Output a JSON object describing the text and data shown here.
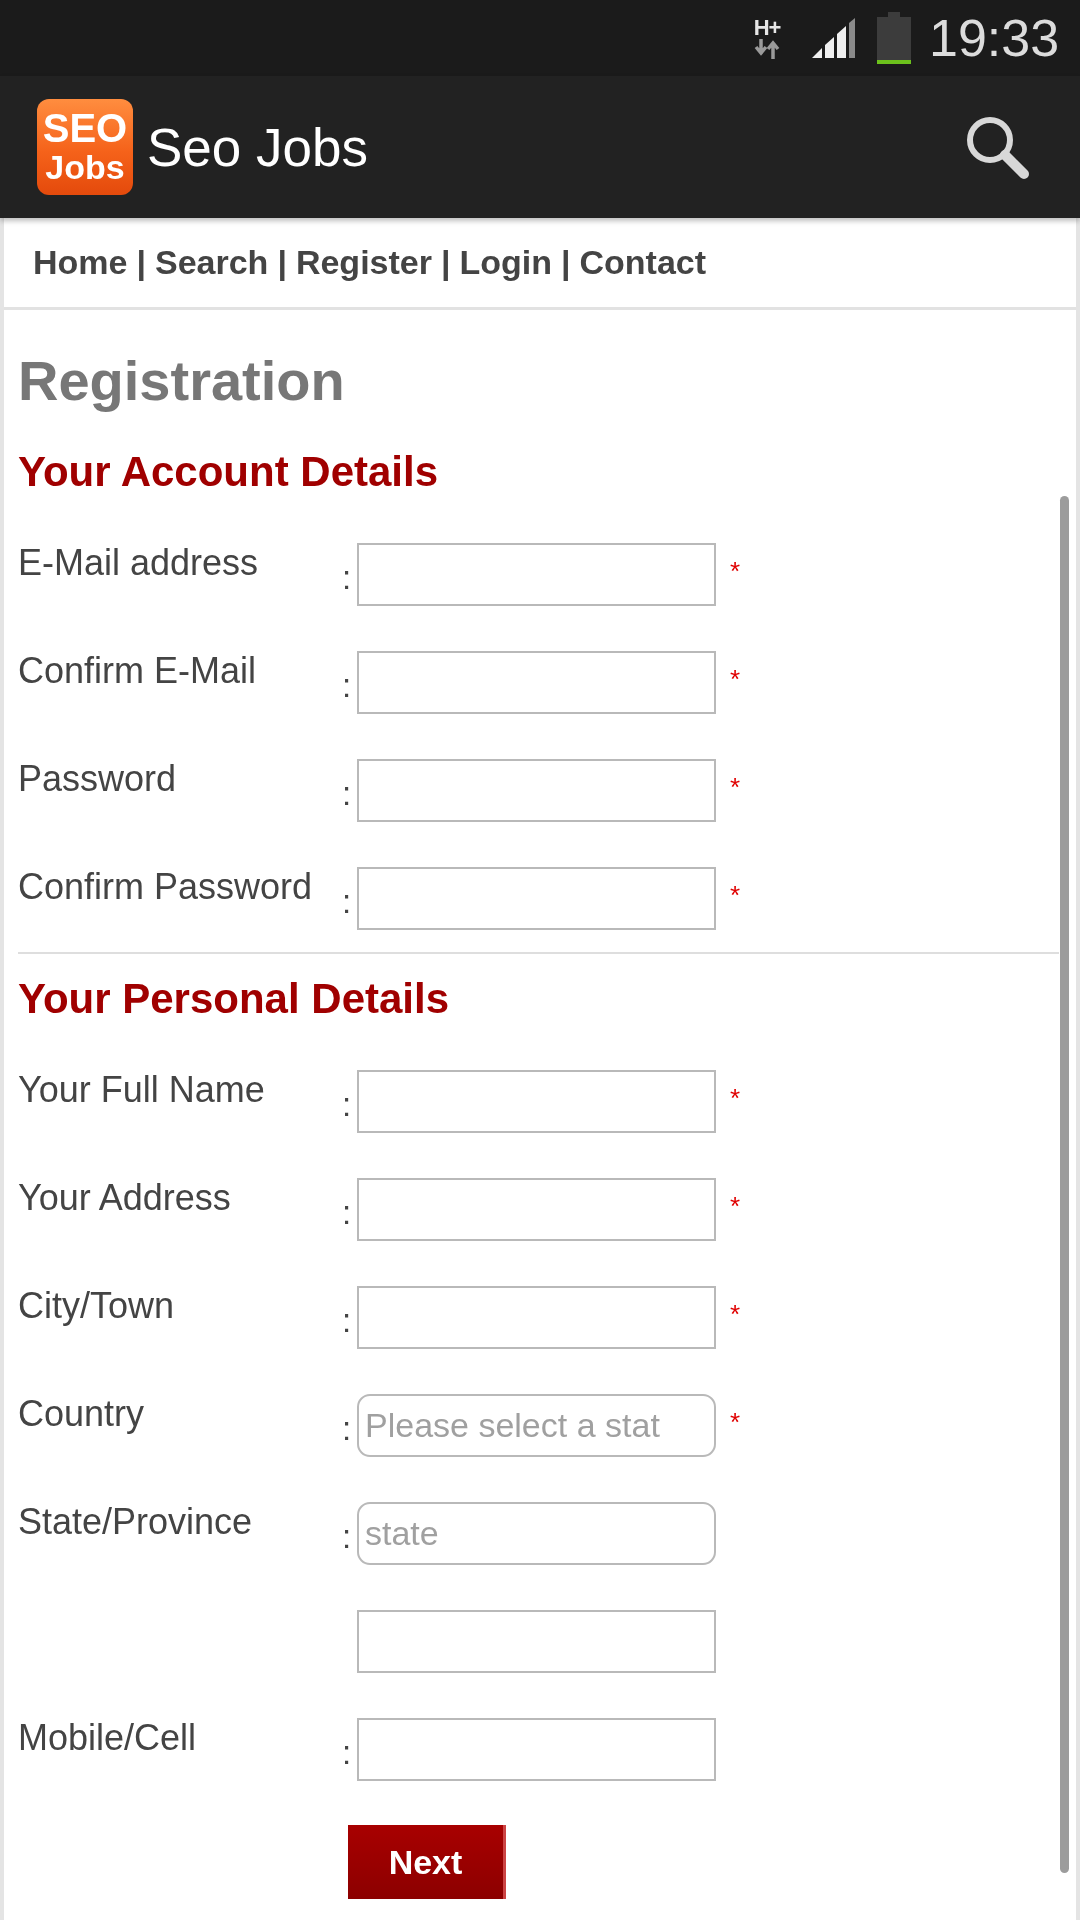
{
  "status_bar": {
    "network_type": "H+",
    "time": "19:33"
  },
  "app_bar": {
    "logo": [
      "SEO",
      "Jobs"
    ],
    "title": "Seo Jobs"
  },
  "nav": {
    "links": [
      "Home",
      "Search",
      "Register",
      "Login",
      "Contact"
    ],
    "separators": [
      "|",
      "|",
      "|",
      "|"
    ]
  },
  "page_title": "Registration",
  "sections": [
    {
      "heading": "Your Account Details",
      "fields": [
        {
          "kind": "text",
          "label": "E-Mail address",
          "colon": ":",
          "required_mark": "*"
        },
        {
          "kind": "text",
          "label": "Confirm E-Mail",
          "colon": ":",
          "required_mark": "*"
        },
        {
          "kind": "text",
          "label": "Password",
          "colon": ":",
          "required_mark": "*"
        },
        {
          "kind": "text",
          "label": "Confirm Password",
          "colon": ":",
          "required_mark": "*"
        }
      ]
    },
    {
      "heading": "Your Personal Details",
      "fields": [
        {
          "kind": "text",
          "label": "Your Full Name",
          "colon": ":",
          "required_mark": "*"
        },
        {
          "kind": "text",
          "label": "Your Address",
          "colon": ":",
          "required_mark": "*"
        },
        {
          "kind": "text",
          "label": "City/Town",
          "colon": ":",
          "required_mark": "*"
        },
        {
          "kind": "combo",
          "label": "Country",
          "colon": ":",
          "placeholder": "Please select a stat",
          "required_mark": "*"
        },
        {
          "kind": "combo",
          "label": "State/Province",
          "colon": ":",
          "placeholder": "state"
        },
        {
          "kind": "text"
        },
        {
          "kind": "text",
          "label": "Mobile/Cell",
          "colon": ":"
        }
      ]
    }
  ],
  "submit_button": "Next"
}
